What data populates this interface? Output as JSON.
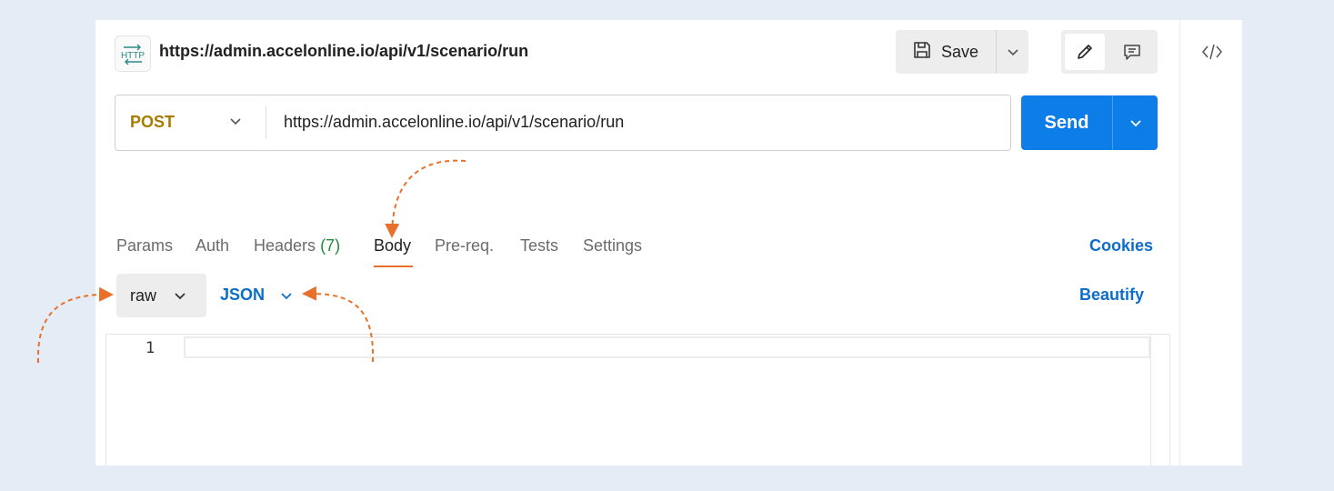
{
  "request": {
    "title": "https://admin.accelonline.io/api/v1/scenario/run",
    "icon": "http-icon"
  },
  "toolbar": {
    "save_label": "Save",
    "send_label": "Send"
  },
  "url_bar": {
    "method": "POST",
    "url": "https://admin.accelonline.io/api/v1/scenario/run"
  },
  "tabs": [
    {
      "label": "Params"
    },
    {
      "label": "Auth"
    },
    {
      "label": "Headers",
      "count": "(7)"
    },
    {
      "label": "Body",
      "active": true
    },
    {
      "label": "Pre-req."
    },
    {
      "label": "Tests"
    },
    {
      "label": "Settings"
    }
  ],
  "cookies_label": "Cookies",
  "body": {
    "mode": "raw",
    "format": "JSON",
    "beautify_label": "Beautify"
  },
  "editor": {
    "line_numbers": [
      "1"
    ]
  },
  "colors": {
    "accent": "#0d7de8",
    "link": "#0d6ec9",
    "method": "#a67c00",
    "annotation": "#e8702a"
  }
}
